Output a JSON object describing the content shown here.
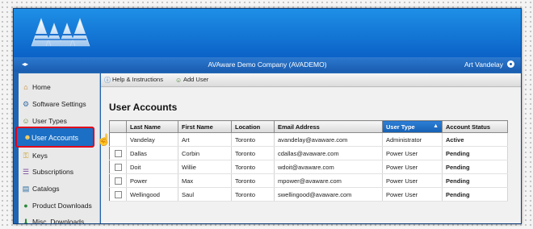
{
  "header": {
    "company": "AVAware Demo Company (AVADEMO)",
    "user_name": "Art Vandelay"
  },
  "sidebar": {
    "items": [
      {
        "label": "Home",
        "icon": "house-icon"
      },
      {
        "label": "Software Settings",
        "icon": "settings-icon"
      },
      {
        "label": "User Types",
        "icon": "user-types-icon"
      },
      {
        "label": "User Accounts",
        "icon": "users-icon",
        "active": true
      },
      {
        "label": "Keys",
        "icon": "key-icon"
      },
      {
        "label": "Subscriptions",
        "icon": "subscriptions-icon"
      },
      {
        "label": "Catalogs",
        "icon": "catalog-icon"
      },
      {
        "label": "Product Downloads",
        "icon": "download-icon"
      },
      {
        "label": "Misc. Downloads",
        "icon": "misc-download-icon"
      }
    ]
  },
  "toolbar": {
    "help_label": "Help & Instructions",
    "add_user_label": "Add User"
  },
  "main": {
    "title": "User Accounts"
  },
  "table": {
    "columns": [
      "Last Name",
      "First Name",
      "Location",
      "Email Address",
      "User Type",
      "Account Status"
    ],
    "sorted_column": "User Type",
    "rows": [
      {
        "last": "Vandelay",
        "first": "Art",
        "location": "Toronto",
        "email": "avandelay@avaware.com",
        "type": "Administrator",
        "status": "Active",
        "checkbox": false
      },
      {
        "last": "Dallas",
        "first": "Corbin",
        "location": "Toronto",
        "email": "cdallas@avaware.com",
        "type": "Power User",
        "status": "Pending",
        "checkbox": true
      },
      {
        "last": "Doit",
        "first": "Willie",
        "location": "Toronto",
        "email": "wdoit@avaware.com",
        "type": "Power User",
        "status": "Pending",
        "checkbox": true
      },
      {
        "last": "Power",
        "first": "Max",
        "location": "Toronto",
        "email": "mpower@avaware.com",
        "type": "Power User",
        "status": "Pending",
        "checkbox": true
      },
      {
        "last": "Wellingood",
        "first": "Saul",
        "location": "Toronto",
        "email": "swellingood@avaware.com",
        "type": "Power User",
        "status": "Pending",
        "checkbox": true
      }
    ]
  },
  "colors": {
    "banner": "#1e8fe6",
    "active_nav": "#1b6fc4",
    "highlight_border": "#e0001b",
    "status_active": "#2e8b1e",
    "status_pending": "#d59100"
  }
}
